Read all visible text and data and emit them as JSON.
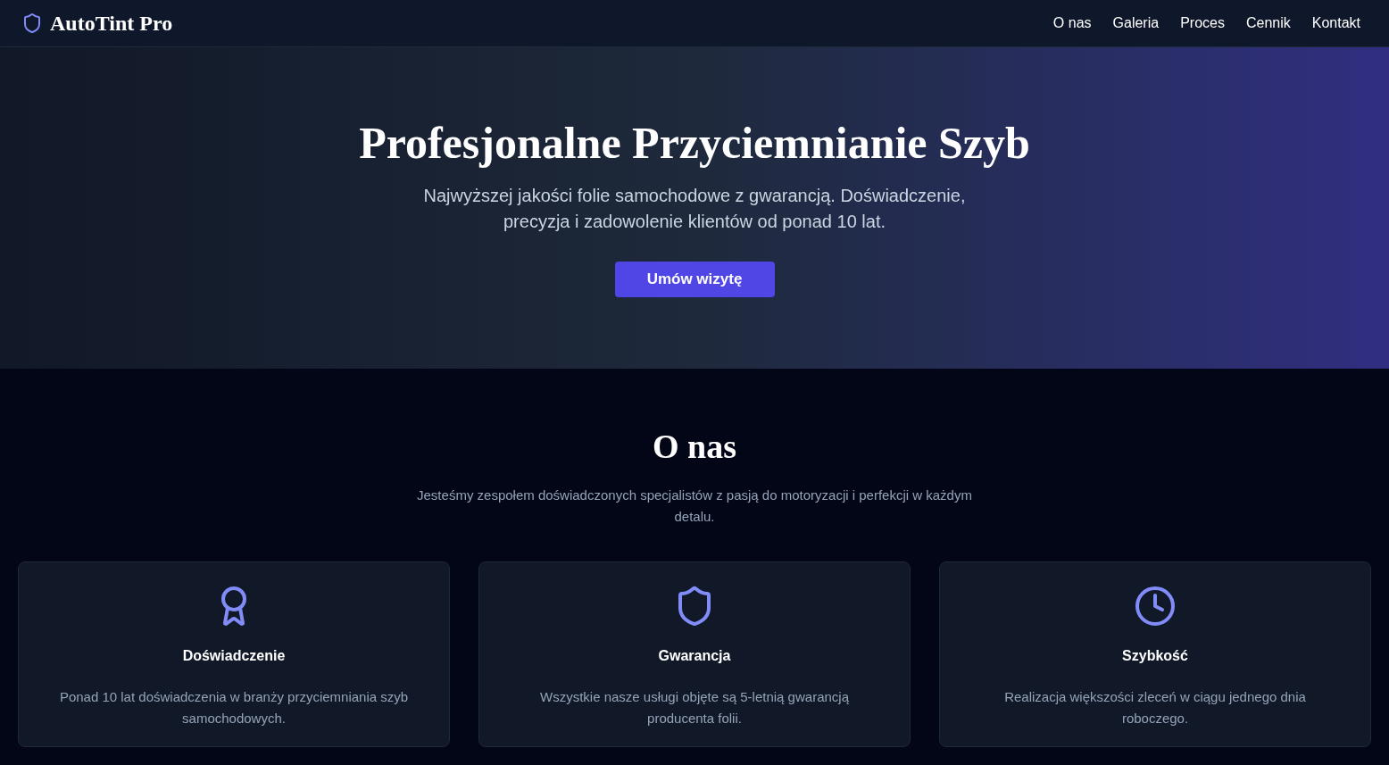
{
  "brand": {
    "name": "AutoTint Pro"
  },
  "nav": [
    {
      "label": "O nas"
    },
    {
      "label": "Galeria"
    },
    {
      "label": "Proces"
    },
    {
      "label": "Cennik"
    },
    {
      "label": "Kontakt"
    }
  ],
  "hero": {
    "title": "Profesjonalne Przyciemnianie Szyb",
    "subtitle": "Najwyższej jakości folie samochodowe z gwarancją. Doświadczenie, precyzja i zadowolenie klientów od ponad 10 lat.",
    "button": "Umów wizytę"
  },
  "about": {
    "title": "O nas",
    "text": "Jesteśmy zespołem doświadczonych specjalistów z pasją do motoryzacji i perfekcji w każdym detalu.",
    "cards": [
      {
        "title": "Doświadczenie",
        "text": "Ponad 10 lat doświadczenia w branży przyciemniania szyb samochodowych."
      },
      {
        "title": "Gwarancja",
        "text": "Wszystkie nasze usługi objęte są 5-letnią gwarancją producenta folii."
      },
      {
        "title": "Szybkość",
        "text": "Realizacja większości zleceń w ciągu jednego dnia roboczego."
      }
    ]
  }
}
